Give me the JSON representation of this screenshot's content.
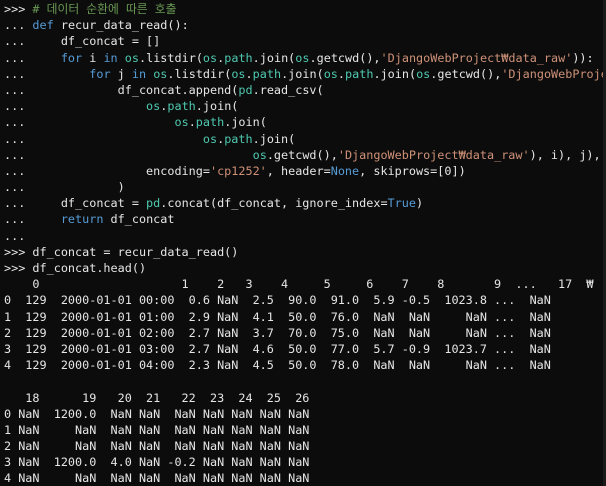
{
  "console": {
    "prompt_primary": ">>> ",
    "prompt_continuation": "... ",
    "lines": [
      {
        "kind": "input",
        "segments": [
          {
            "text": ">>> ",
            "cls": ""
          },
          {
            "text": "# 데이터 순환에 따른 호출",
            "cls": "comment"
          }
        ]
      },
      {
        "kind": "input",
        "segments": [
          {
            "text": "... ",
            "cls": ""
          },
          {
            "text": "def",
            "cls": "kw"
          },
          {
            "text": " recur_data_read():",
            "cls": ""
          }
        ]
      },
      {
        "kind": "input",
        "segments": [
          {
            "text": "...     df_concat = []",
            "cls": ""
          }
        ]
      },
      {
        "kind": "input",
        "segments": [
          {
            "text": "...     ",
            "cls": ""
          },
          {
            "text": "for",
            "cls": "kw"
          },
          {
            "text": " i ",
            "cls": ""
          },
          {
            "text": "in",
            "cls": "kw"
          },
          {
            "text": " ",
            "cls": ""
          },
          {
            "text": "os",
            "cls": "mod"
          },
          {
            "text": ".listdir(",
            "cls": ""
          },
          {
            "text": "os",
            "cls": "mod"
          },
          {
            "text": ".",
            "cls": ""
          },
          {
            "text": "path",
            "cls": "mod"
          },
          {
            "text": ".join(",
            "cls": ""
          },
          {
            "text": "os",
            "cls": "mod"
          },
          {
            "text": ".getcwd(),",
            "cls": ""
          },
          {
            "text": "'DjangoWebProject₩data_raw'",
            "cls": "str"
          },
          {
            "text": ")):",
            "cls": ""
          }
        ]
      },
      {
        "kind": "input",
        "segments": [
          {
            "text": "...         ",
            "cls": ""
          },
          {
            "text": "for",
            "cls": "kw"
          },
          {
            "text": " j ",
            "cls": ""
          },
          {
            "text": "in",
            "cls": "kw"
          },
          {
            "text": " ",
            "cls": ""
          },
          {
            "text": "os",
            "cls": "mod"
          },
          {
            "text": ".listdir(",
            "cls": ""
          },
          {
            "text": "os",
            "cls": "mod"
          },
          {
            "text": ".",
            "cls": ""
          },
          {
            "text": "path",
            "cls": "mod"
          },
          {
            "text": ".join(",
            "cls": ""
          },
          {
            "text": "os",
            "cls": "mod"
          },
          {
            "text": ".",
            "cls": ""
          },
          {
            "text": "path",
            "cls": "mod"
          },
          {
            "text": ".join(",
            "cls": ""
          },
          {
            "text": "os",
            "cls": "mod"
          },
          {
            "text": ".getcwd(),",
            "cls": ""
          },
          {
            "text": "'DjangoWebProjec",
            "cls": "str"
          }
        ]
      },
      {
        "kind": "input",
        "segments": [
          {
            "text": "...             df_concat.append(",
            "cls": ""
          },
          {
            "text": "pd",
            "cls": "mod"
          },
          {
            "text": ".read_csv(",
            "cls": ""
          }
        ]
      },
      {
        "kind": "input",
        "segments": [
          {
            "text": "...                 ",
            "cls": ""
          },
          {
            "text": "os",
            "cls": "mod"
          },
          {
            "text": ".",
            "cls": ""
          },
          {
            "text": "path",
            "cls": "mod"
          },
          {
            "text": ".join(",
            "cls": ""
          }
        ]
      },
      {
        "kind": "input",
        "segments": [
          {
            "text": "...                     ",
            "cls": ""
          },
          {
            "text": "os",
            "cls": "mod"
          },
          {
            "text": ".",
            "cls": ""
          },
          {
            "text": "path",
            "cls": "mod"
          },
          {
            "text": ".join(",
            "cls": ""
          }
        ]
      },
      {
        "kind": "input",
        "segments": [
          {
            "text": "...                         ",
            "cls": ""
          },
          {
            "text": "os",
            "cls": "mod"
          },
          {
            "text": ".",
            "cls": ""
          },
          {
            "text": "path",
            "cls": "mod"
          },
          {
            "text": ".join(",
            "cls": ""
          }
        ]
      },
      {
        "kind": "input",
        "segments": [
          {
            "text": "...                                ",
            "cls": ""
          },
          {
            "text": "os",
            "cls": "mod"
          },
          {
            "text": ".getcwd(),",
            "cls": ""
          },
          {
            "text": "'DjangoWebProject₩data_raw'",
            "cls": "str"
          },
          {
            "text": "), i), j),",
            "cls": ""
          }
        ]
      },
      {
        "kind": "input",
        "segments": [
          {
            "text": "...                 encoding=",
            "cls": ""
          },
          {
            "text": "'cp1252'",
            "cls": "str"
          },
          {
            "text": ", header=",
            "cls": ""
          },
          {
            "text": "None",
            "cls": "kw"
          },
          {
            "text": ", skiprows=[0])",
            "cls": ""
          }
        ]
      },
      {
        "kind": "input",
        "segments": [
          {
            "text": "...             )",
            "cls": ""
          }
        ]
      },
      {
        "kind": "input",
        "segments": [
          {
            "text": "...     df_concat = ",
            "cls": ""
          },
          {
            "text": "pd",
            "cls": "mod"
          },
          {
            "text": ".concat(df_concat, ignore_index=",
            "cls": ""
          },
          {
            "text": "True",
            "cls": "kw"
          },
          {
            "text": ")",
            "cls": ""
          }
        ]
      },
      {
        "kind": "input",
        "segments": [
          {
            "text": "...     ",
            "cls": ""
          },
          {
            "text": "return",
            "cls": "kw"
          },
          {
            "text": " df_concat",
            "cls": ""
          }
        ]
      },
      {
        "kind": "input",
        "segments": [
          {
            "text": "...",
            "cls": ""
          }
        ]
      },
      {
        "kind": "input",
        "segments": [
          {
            "text": ">>> df_concat = recur_data_read()",
            "cls": ""
          }
        ]
      },
      {
        "kind": "input",
        "segments": [
          {
            "text": ">>> df_concat.head()",
            "cls": ""
          }
        ]
      },
      {
        "kind": "output",
        "segments": [
          {
            "text": "    0                    1    2   3    4     5     6    7    8       9  ...   17  ₩",
            "cls": ""
          }
        ]
      },
      {
        "kind": "output",
        "segments": [
          {
            "text": "0  129  2000-01-01 00:00  0.6 NaN  2.5  90.0  91.0  5.9 -0.5  1023.8 ...  NaN",
            "cls": ""
          }
        ]
      },
      {
        "kind": "output",
        "segments": [
          {
            "text": "1  129  2000-01-01 01:00  2.9 NaN  4.1  50.0  76.0  NaN  NaN     NaN ...  NaN",
            "cls": ""
          }
        ]
      },
      {
        "kind": "output",
        "segments": [
          {
            "text": "2  129  2000-01-01 02:00  2.7 NaN  3.7  70.0  75.0  NaN  NaN     NaN ...  NaN",
            "cls": ""
          }
        ]
      },
      {
        "kind": "output",
        "segments": [
          {
            "text": "3  129  2000-01-01 03:00  2.7 NaN  4.6  50.0  77.0  5.7 -0.9  1023.7 ...  NaN",
            "cls": ""
          }
        ]
      },
      {
        "kind": "output",
        "segments": [
          {
            "text": "4  129  2000-01-01 04:00  2.3 NaN  4.5  50.0  78.0  NaN  NaN     NaN ...  NaN",
            "cls": ""
          }
        ]
      },
      {
        "kind": "output",
        "segments": [
          {
            "text": "",
            "cls": ""
          }
        ]
      },
      {
        "kind": "output",
        "segments": [
          {
            "text": "   18      19   20  21   22  23  24  25  26",
            "cls": ""
          }
        ]
      },
      {
        "kind": "output",
        "segments": [
          {
            "text": "0 NaN  1200.0  NaN NaN  NaN NaN NaN NaN NaN",
            "cls": ""
          }
        ]
      },
      {
        "kind": "output",
        "segments": [
          {
            "text": "1 NaN     NaN  NaN NaN  NaN NaN NaN NaN NaN",
            "cls": ""
          }
        ]
      },
      {
        "kind": "output",
        "segments": [
          {
            "text": "2 NaN     NaN  NaN NaN  NaN NaN NaN NaN NaN",
            "cls": ""
          }
        ]
      },
      {
        "kind": "output",
        "segments": [
          {
            "text": "3 NaN  1200.0  4.0 NaN -0.2 NaN NaN NaN NaN",
            "cls": ""
          }
        ]
      },
      {
        "kind": "output",
        "segments": [
          {
            "text": "4 NaN     NaN  NaN NaN  NaN NaN NaN NaN NaN",
            "cls": ""
          }
        ]
      }
    ]
  },
  "theme": {
    "background": "#0c0c0c",
    "foreground": "#e6e6e6",
    "keyword": "#569cd6",
    "module": "#4ec9b0",
    "string": "#ce9178",
    "comment": "#6a9955"
  }
}
